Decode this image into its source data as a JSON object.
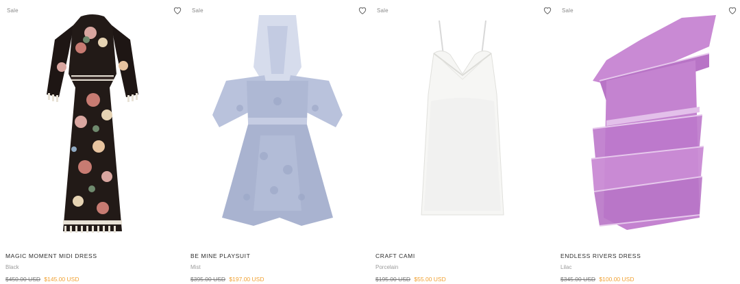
{
  "products": [
    {
      "badge": "Sale",
      "name": "MAGIC MOMENT MIDI DRESS",
      "color": "Black",
      "old_price": "$450.00 USD",
      "new_price": "$145.00 USD"
    },
    {
      "badge": "Sale",
      "name": "BE MINE PLAYSUIT",
      "color": "Mist",
      "old_price": "$395.00 USD",
      "new_price": "$197.00 USD"
    },
    {
      "badge": "Sale",
      "name": "CRAFT CAMI",
      "color": "Porcelain",
      "old_price": "$195.00 USD",
      "new_price": "$55.00 USD"
    },
    {
      "badge": "Sale",
      "name": "ENDLESS RIVERS DRESS",
      "color": "Lilac",
      "old_price": "$345.00 USD",
      "new_price": "$100.00 USD"
    }
  ],
  "icons": {
    "favorite": "heart-outline-icon"
  },
  "colors": {
    "sale_price": "#f0a030",
    "old_price": "#777777",
    "color_text": "#9b9b9b"
  }
}
